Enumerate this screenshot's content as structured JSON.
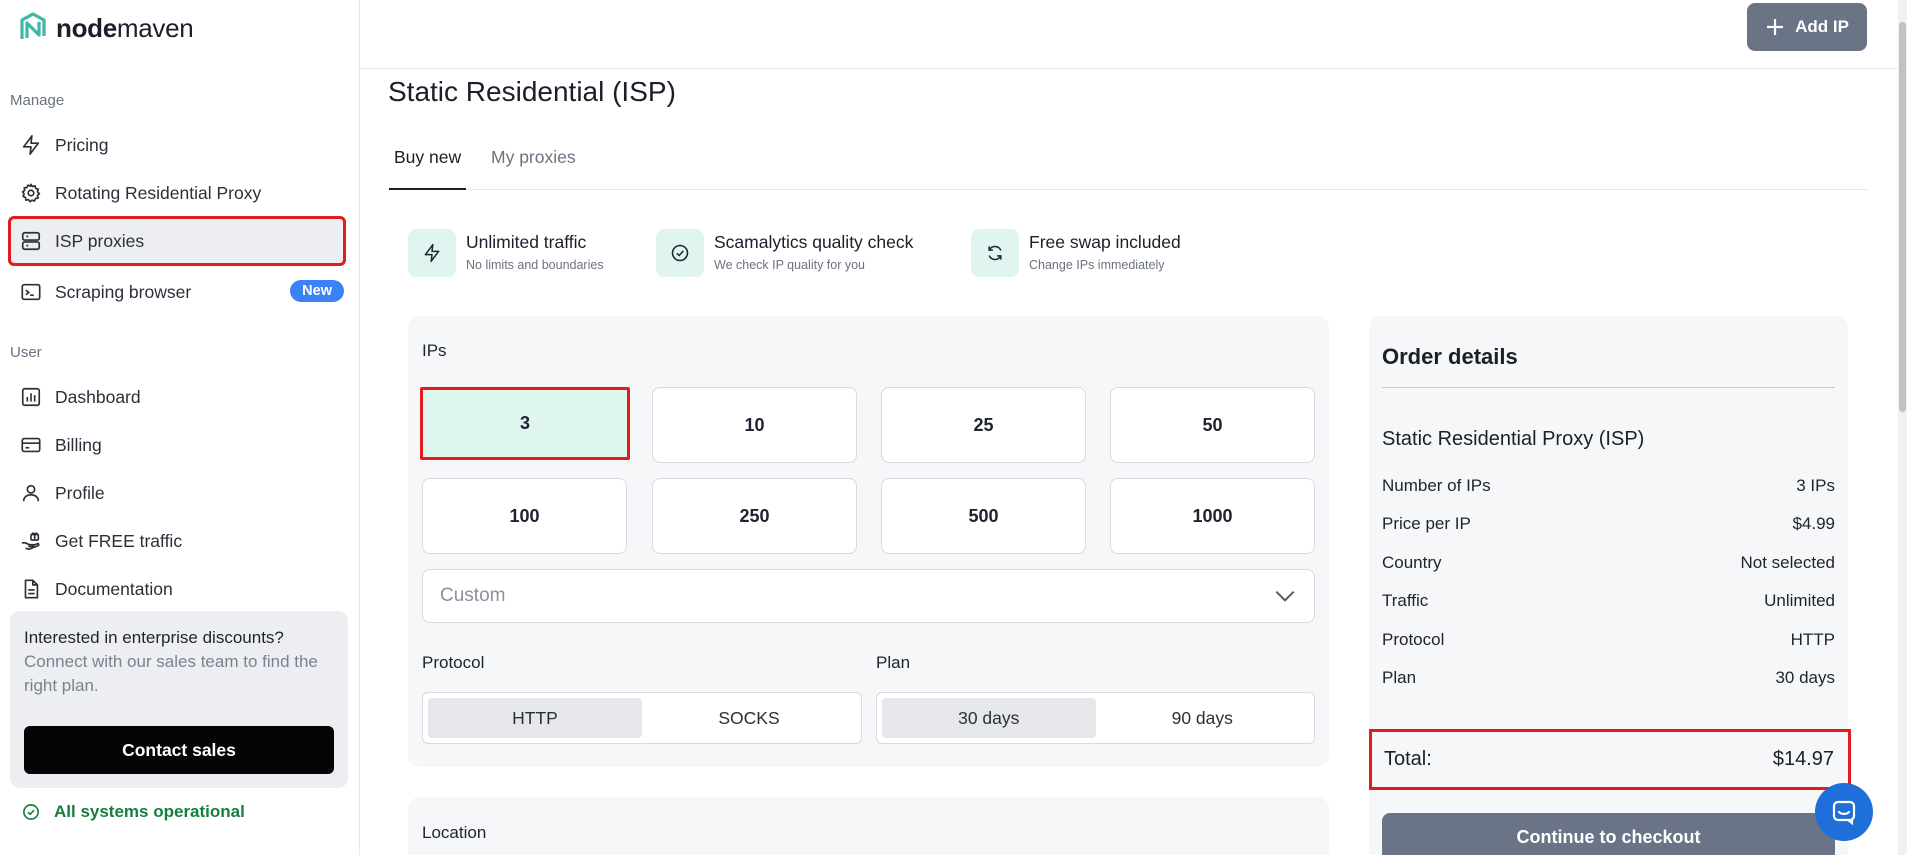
{
  "brand": {
    "name_bold": "node",
    "name_light": "maven"
  },
  "sidebar": {
    "manage_label": "Manage",
    "manage_items": [
      {
        "label": "Pricing",
        "icon": "bolt-icon"
      },
      {
        "label": "Rotating Residential Proxy",
        "icon": "gear-icon"
      },
      {
        "label": "ISP proxies",
        "icon": "server-icon"
      },
      {
        "label": "Scraping browser",
        "icon": "terminal-icon",
        "badge": "New"
      }
    ],
    "user_label": "User",
    "user_items": [
      {
        "label": "Dashboard",
        "icon": "bar-chart-icon"
      },
      {
        "label": "Billing",
        "icon": "credit-card-icon"
      },
      {
        "label": "Profile",
        "icon": "user-icon"
      },
      {
        "label": "Get FREE traffic",
        "icon": "hand-gift-icon"
      },
      {
        "label": "Documentation",
        "icon": "document-icon"
      }
    ],
    "promo": {
      "title": "Interested in enterprise discounts?",
      "text": "Connect with our sales team to find the right plan.",
      "button": "Contact sales"
    },
    "status": "All systems operational"
  },
  "header": {
    "add_ip": "Add IP"
  },
  "page": {
    "title": "Static Residential (ISP)",
    "tabs": [
      "Buy new",
      "My proxies"
    ]
  },
  "features": [
    {
      "title": "Unlimited traffic",
      "sub": "No limits and boundaries",
      "icon": "bolt-icon"
    },
    {
      "title": "Scamalytics quality check",
      "sub": "We check IP quality for you",
      "icon": "check-circle-icon"
    },
    {
      "title": "Free swap included",
      "sub": "Change IPs immediately",
      "icon": "refresh-icon"
    }
  ],
  "ips": {
    "label": "IPs",
    "options": [
      "3",
      "10",
      "25",
      "50",
      "100",
      "250",
      "500",
      "1000"
    ],
    "selected": "3",
    "custom_placeholder": "Custom"
  },
  "protocol": {
    "label": "Protocol",
    "options": [
      "HTTP",
      "SOCKS"
    ],
    "selected": "HTTP"
  },
  "plan": {
    "label": "Plan",
    "options": [
      "30 days",
      "90 days"
    ],
    "selected": "30 days"
  },
  "location": {
    "label": "Location"
  },
  "order": {
    "title": "Order details",
    "product": "Static Residential Proxy (ISP)",
    "rows": [
      {
        "label": "Number of IPs",
        "value": "3 IPs"
      },
      {
        "label": "Price per IP",
        "value": "$4.99"
      },
      {
        "label": "Country",
        "value": "Not selected"
      },
      {
        "label": "Traffic",
        "value": "Unlimited"
      },
      {
        "label": "Protocol",
        "value": "HTTP"
      },
      {
        "label": "Plan",
        "value": "30 days"
      }
    ],
    "total_label": "Total:",
    "total_value": "$14.97",
    "checkout": "Continue to checkout"
  },
  "colors": {
    "accent_mint": "#dff7ee",
    "highlight_red": "#e31b1b",
    "button_gray": "#6b7386",
    "status_green": "#15803d",
    "badge_blue": "#3b82f6"
  }
}
